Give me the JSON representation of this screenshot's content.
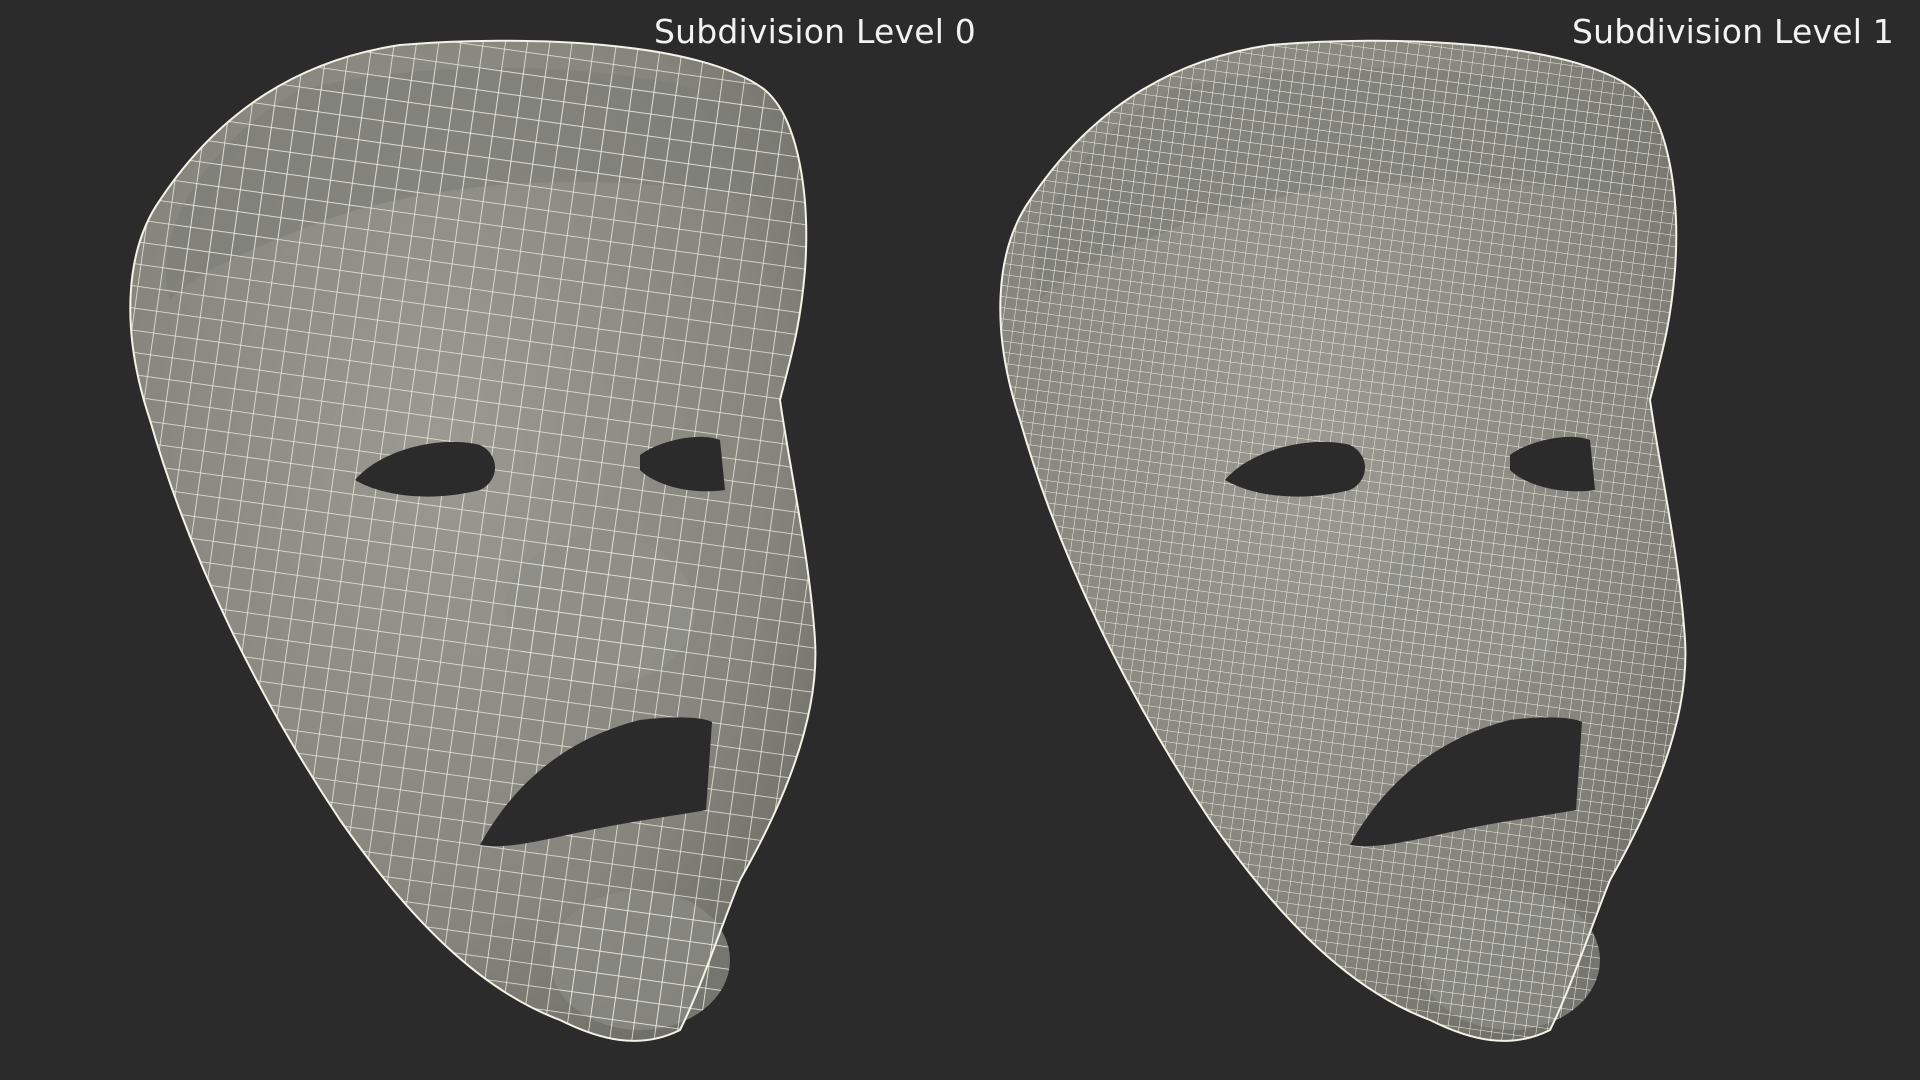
{
  "labels": {
    "left": "Subdivision Level 0",
    "right": "Subdivision Level 1"
  },
  "colors": {
    "background": "#2b2b2b",
    "mask_fill": "#8b8b84",
    "mask_shadow": "#6e6e68",
    "wire": "#f4f2e6",
    "label_text": "#f2f2f2"
  },
  "panels": [
    {
      "name": "subdivision-level-0",
      "wire_density": "low"
    },
    {
      "name": "subdivision-level-1",
      "wire_density": "high"
    }
  ]
}
